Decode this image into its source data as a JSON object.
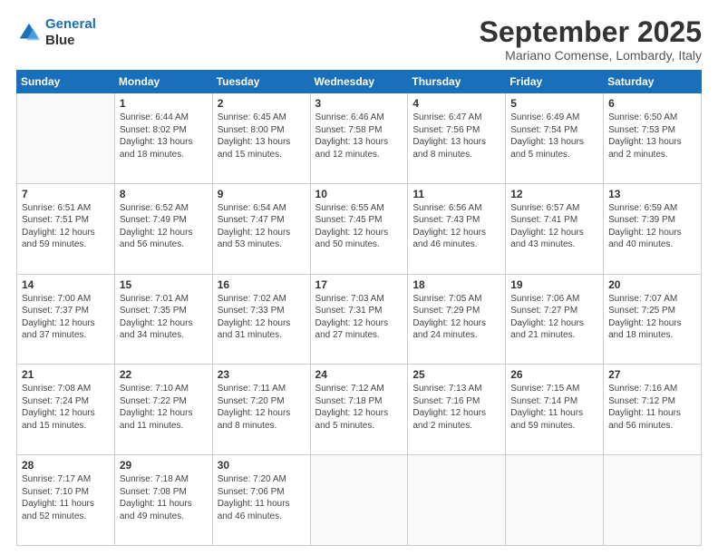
{
  "logo": {
    "line1": "General",
    "line2": "Blue"
  },
  "title": "September 2025",
  "location": "Mariano Comense, Lombardy, Italy",
  "weekdays": [
    "Sunday",
    "Monday",
    "Tuesday",
    "Wednesday",
    "Thursday",
    "Friday",
    "Saturday"
  ],
  "weeks": [
    [
      {
        "day": "",
        "sunrise": "",
        "sunset": "",
        "daylight": ""
      },
      {
        "day": "1",
        "sunrise": "Sunrise: 6:44 AM",
        "sunset": "Sunset: 8:02 PM",
        "daylight": "Daylight: 13 hours and 18 minutes."
      },
      {
        "day": "2",
        "sunrise": "Sunrise: 6:45 AM",
        "sunset": "Sunset: 8:00 PM",
        "daylight": "Daylight: 13 hours and 15 minutes."
      },
      {
        "day": "3",
        "sunrise": "Sunrise: 6:46 AM",
        "sunset": "Sunset: 7:58 PM",
        "daylight": "Daylight: 13 hours and 12 minutes."
      },
      {
        "day": "4",
        "sunrise": "Sunrise: 6:47 AM",
        "sunset": "Sunset: 7:56 PM",
        "daylight": "Daylight: 13 hours and 8 minutes."
      },
      {
        "day": "5",
        "sunrise": "Sunrise: 6:49 AM",
        "sunset": "Sunset: 7:54 PM",
        "daylight": "Daylight: 13 hours and 5 minutes."
      },
      {
        "day": "6",
        "sunrise": "Sunrise: 6:50 AM",
        "sunset": "Sunset: 7:53 PM",
        "daylight": "Daylight: 13 hours and 2 minutes."
      }
    ],
    [
      {
        "day": "7",
        "sunrise": "Sunrise: 6:51 AM",
        "sunset": "Sunset: 7:51 PM",
        "daylight": "Daylight: 12 hours and 59 minutes."
      },
      {
        "day": "8",
        "sunrise": "Sunrise: 6:52 AM",
        "sunset": "Sunset: 7:49 PM",
        "daylight": "Daylight: 12 hours and 56 minutes."
      },
      {
        "day": "9",
        "sunrise": "Sunrise: 6:54 AM",
        "sunset": "Sunset: 7:47 PM",
        "daylight": "Daylight: 12 hours and 53 minutes."
      },
      {
        "day": "10",
        "sunrise": "Sunrise: 6:55 AM",
        "sunset": "Sunset: 7:45 PM",
        "daylight": "Daylight: 12 hours and 50 minutes."
      },
      {
        "day": "11",
        "sunrise": "Sunrise: 6:56 AM",
        "sunset": "Sunset: 7:43 PM",
        "daylight": "Daylight: 12 hours and 46 minutes."
      },
      {
        "day": "12",
        "sunrise": "Sunrise: 6:57 AM",
        "sunset": "Sunset: 7:41 PM",
        "daylight": "Daylight: 12 hours and 43 minutes."
      },
      {
        "day": "13",
        "sunrise": "Sunrise: 6:59 AM",
        "sunset": "Sunset: 7:39 PM",
        "daylight": "Daylight: 12 hours and 40 minutes."
      }
    ],
    [
      {
        "day": "14",
        "sunrise": "Sunrise: 7:00 AM",
        "sunset": "Sunset: 7:37 PM",
        "daylight": "Daylight: 12 hours and 37 minutes."
      },
      {
        "day": "15",
        "sunrise": "Sunrise: 7:01 AM",
        "sunset": "Sunset: 7:35 PM",
        "daylight": "Daylight: 12 hours and 34 minutes."
      },
      {
        "day": "16",
        "sunrise": "Sunrise: 7:02 AM",
        "sunset": "Sunset: 7:33 PM",
        "daylight": "Daylight: 12 hours and 31 minutes."
      },
      {
        "day": "17",
        "sunrise": "Sunrise: 7:03 AM",
        "sunset": "Sunset: 7:31 PM",
        "daylight": "Daylight: 12 hours and 27 minutes."
      },
      {
        "day": "18",
        "sunrise": "Sunrise: 7:05 AM",
        "sunset": "Sunset: 7:29 PM",
        "daylight": "Daylight: 12 hours and 24 minutes."
      },
      {
        "day": "19",
        "sunrise": "Sunrise: 7:06 AM",
        "sunset": "Sunset: 7:27 PM",
        "daylight": "Daylight: 12 hours and 21 minutes."
      },
      {
        "day": "20",
        "sunrise": "Sunrise: 7:07 AM",
        "sunset": "Sunset: 7:25 PM",
        "daylight": "Daylight: 12 hours and 18 minutes."
      }
    ],
    [
      {
        "day": "21",
        "sunrise": "Sunrise: 7:08 AM",
        "sunset": "Sunset: 7:24 PM",
        "daylight": "Daylight: 12 hours and 15 minutes."
      },
      {
        "day": "22",
        "sunrise": "Sunrise: 7:10 AM",
        "sunset": "Sunset: 7:22 PM",
        "daylight": "Daylight: 12 hours and 11 minutes."
      },
      {
        "day": "23",
        "sunrise": "Sunrise: 7:11 AM",
        "sunset": "Sunset: 7:20 PM",
        "daylight": "Daylight: 12 hours and 8 minutes."
      },
      {
        "day": "24",
        "sunrise": "Sunrise: 7:12 AM",
        "sunset": "Sunset: 7:18 PM",
        "daylight": "Daylight: 12 hours and 5 minutes."
      },
      {
        "day": "25",
        "sunrise": "Sunrise: 7:13 AM",
        "sunset": "Sunset: 7:16 PM",
        "daylight": "Daylight: 12 hours and 2 minutes."
      },
      {
        "day": "26",
        "sunrise": "Sunrise: 7:15 AM",
        "sunset": "Sunset: 7:14 PM",
        "daylight": "Daylight: 11 hours and 59 minutes."
      },
      {
        "day": "27",
        "sunrise": "Sunrise: 7:16 AM",
        "sunset": "Sunset: 7:12 PM",
        "daylight": "Daylight: 11 hours and 56 minutes."
      }
    ],
    [
      {
        "day": "28",
        "sunrise": "Sunrise: 7:17 AM",
        "sunset": "Sunset: 7:10 PM",
        "daylight": "Daylight: 11 hours and 52 minutes."
      },
      {
        "day": "29",
        "sunrise": "Sunrise: 7:18 AM",
        "sunset": "Sunset: 7:08 PM",
        "daylight": "Daylight: 11 hours and 49 minutes."
      },
      {
        "day": "30",
        "sunrise": "Sunrise: 7:20 AM",
        "sunset": "Sunset: 7:06 PM",
        "daylight": "Daylight: 11 hours and 46 minutes."
      },
      {
        "day": "",
        "sunrise": "",
        "sunset": "",
        "daylight": ""
      },
      {
        "day": "",
        "sunrise": "",
        "sunset": "",
        "daylight": ""
      },
      {
        "day": "",
        "sunrise": "",
        "sunset": "",
        "daylight": ""
      },
      {
        "day": "",
        "sunrise": "",
        "sunset": "",
        "daylight": ""
      }
    ]
  ]
}
